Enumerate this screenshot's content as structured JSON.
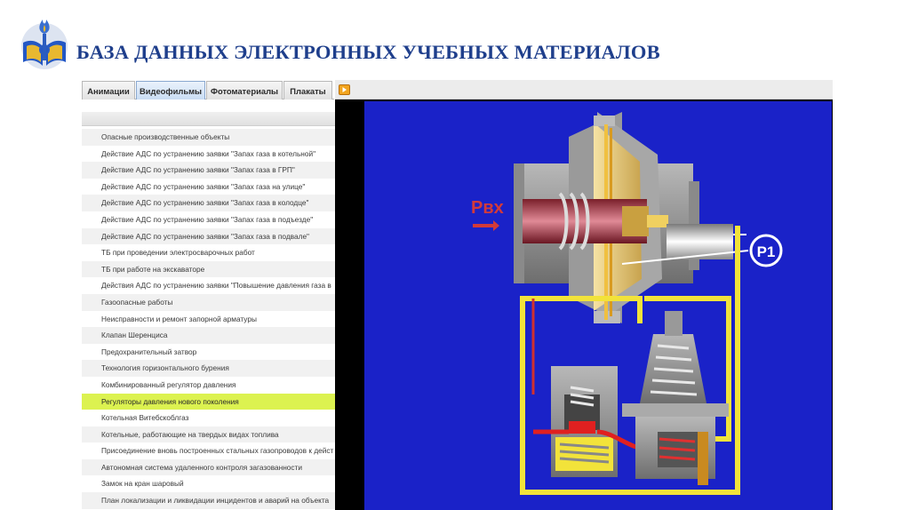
{
  "header": {
    "title": "БАЗА ДАННЫХ ЭЛЕКТРОННЫХ УЧЕБНЫХ МАТЕРИАЛОВ"
  },
  "tabs": [
    {
      "label": "Анимации",
      "active": false
    },
    {
      "label": "Видеофильмы",
      "active": true
    },
    {
      "label": "Фотоматериалы",
      "active": false
    },
    {
      "label": "Плакаты",
      "active": false
    }
  ],
  "list": {
    "selected_index": 16,
    "items": [
      "Опасные производственные объекты",
      "Действие АДС по устранению заявки \"Запах газа в котельной\"",
      "Действие АДС по устранению заявки \"Запах газа в ГРП\"",
      "Действие АДС по устранению заявки \"Запах газа на улице\"",
      "Действие АДС по устранению заявки \"Запах газа в колодце\"",
      "Действие АДС по устранению заявки \"Запах газа в подъезде\"",
      "Действие АДС по устранению заявки \"Запах газа в подвале\"",
      "ТБ при проведении электросварочных работ",
      "ТБ при работе на экскаваторе",
      "Действия АДС по устранению заявки \"Повышение давления газа в",
      "Газоопасные работы",
      "Неисправности и ремонт запорной арматуры",
      "Клапан Шеренциса",
      "Предохранительный затвор",
      "Технология горизонтального бурения",
      "Комбинированный регулятор давления",
      "Регуляторы давления нового поколения",
      "Котельная Витебскоблгаз",
      "Котельные, работающие на твердых видах топлива",
      "Присоединение вновь построенных стальных газопроводов к дейст",
      "Автономная система удаленного контроля загазованности",
      "Замок на кран шаровый",
      "План локализации и ликвидации инцидентов и аварий на объекта"
    ]
  },
  "video": {
    "label_inlet": "Рвх",
    "label_p1": "Р1"
  },
  "colors": {
    "title": "#1f3f8c",
    "selected_row": "#dcf250",
    "video_background": "#1a22c8",
    "pipe_yellow": "#f2e33a"
  }
}
